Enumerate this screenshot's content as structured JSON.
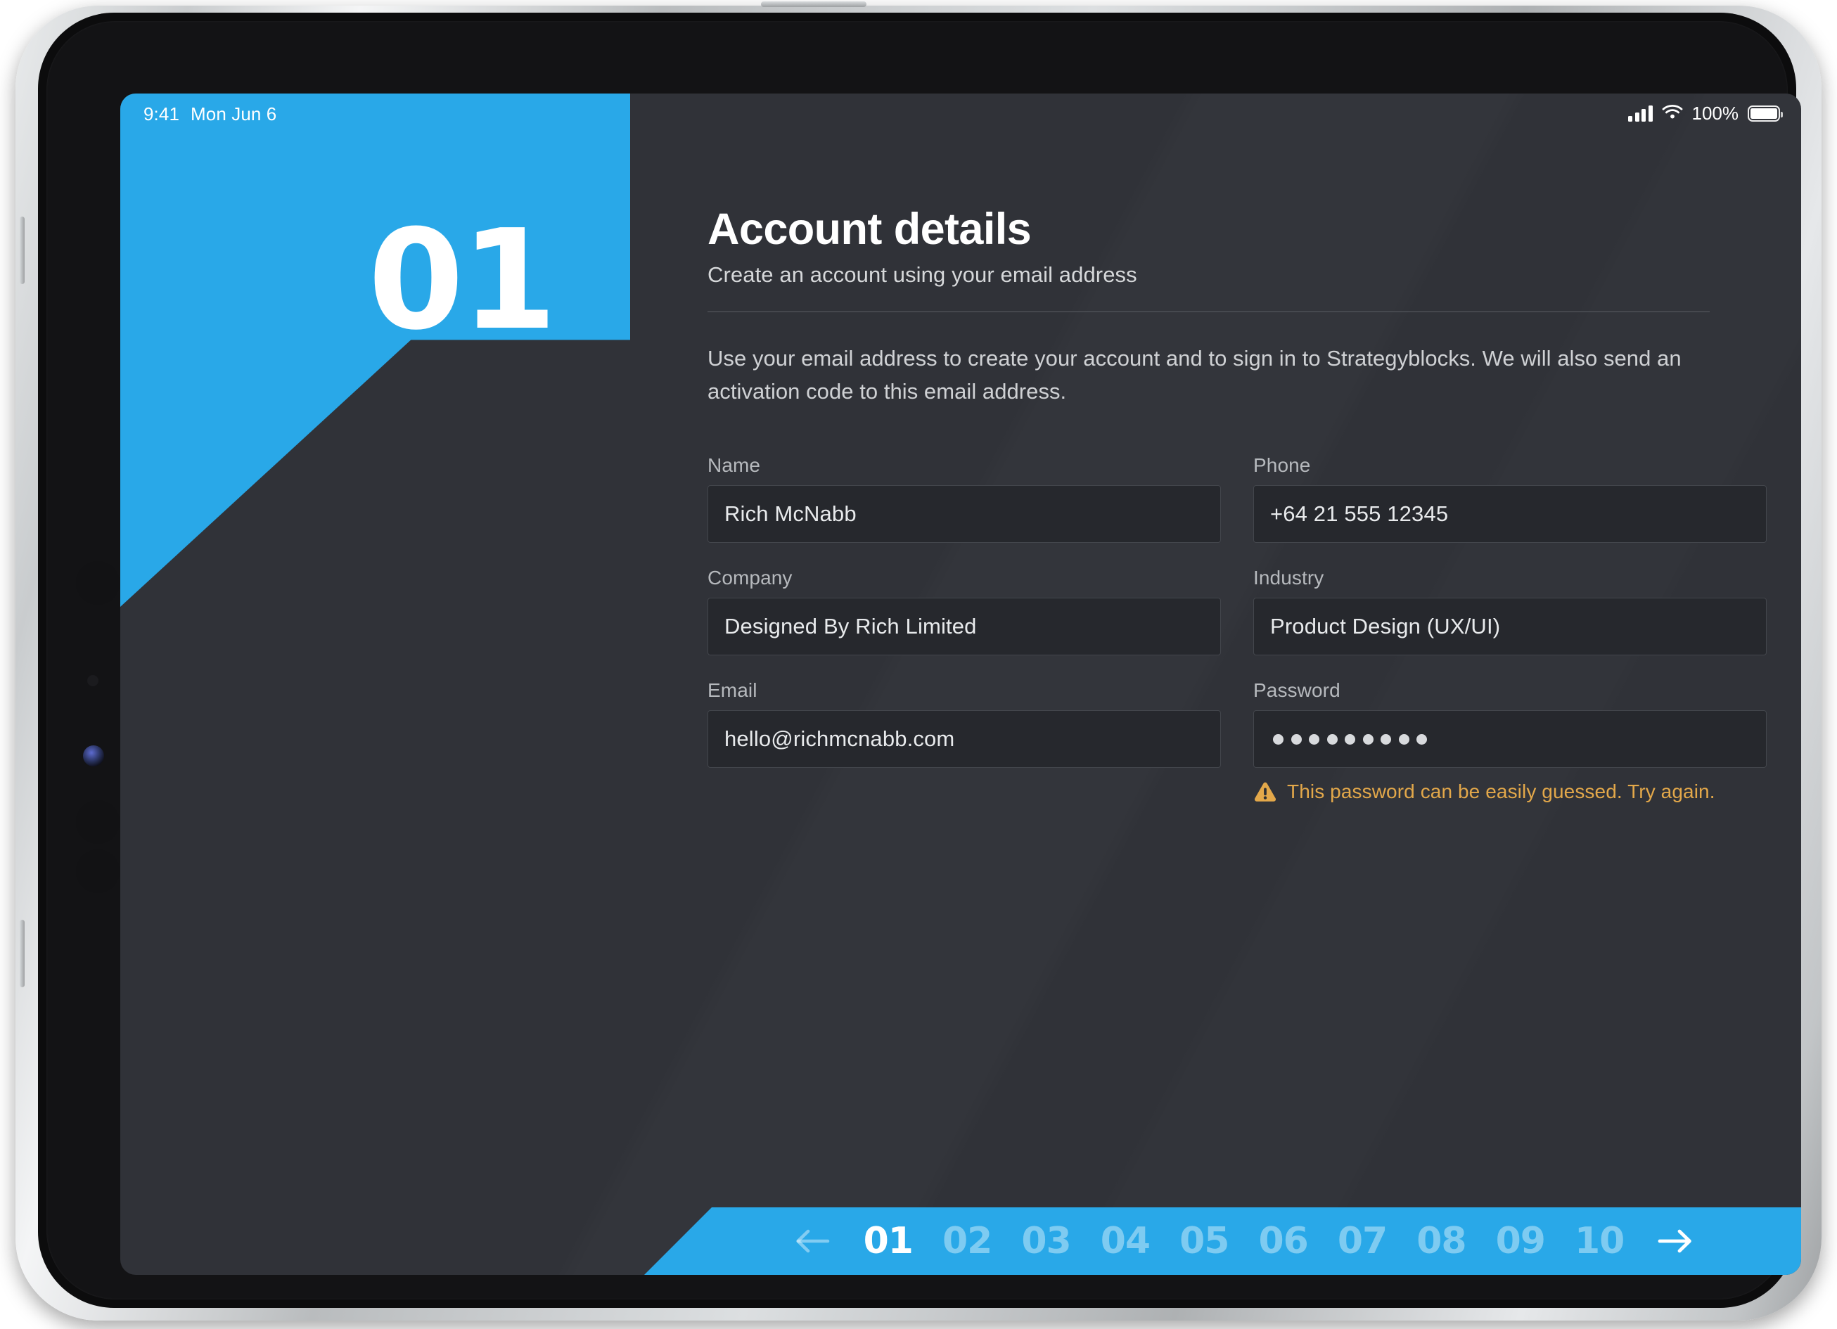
{
  "colors": {
    "accent": "#29a8e8",
    "canvas": "#303238",
    "field_fill": "#26282d",
    "field_border": "#43464c",
    "warning": "#e3a84a",
    "text_primary": "#ffffff",
    "text_secondary": "#cfd1d4"
  },
  "status_bar": {
    "time": "9:41",
    "date": "Mon Jun 6",
    "battery_percent": "100%",
    "signal_icon": "cellular-signal-icon",
    "wifi_icon": "wifi-icon",
    "battery_icon": "battery-full-icon"
  },
  "step_badge": {
    "number": "01"
  },
  "header": {
    "title": "Account details",
    "subtitle": "Create an account using your email address",
    "paragraph": "Use your email address to create your account and to sign in to Strategyblocks. We will also send an activation code to this email address."
  },
  "form": {
    "fields": [
      {
        "id": "name",
        "label": "Name",
        "value": "Rich McNabb",
        "type": "text"
      },
      {
        "id": "phone",
        "label": "Phone",
        "value": "+64 21 555 12345",
        "type": "text"
      },
      {
        "id": "company",
        "label": "Company",
        "value": "Designed By Rich Limited",
        "type": "text"
      },
      {
        "id": "industry",
        "label": "Industry",
        "value": "Product Design (UX/UI)",
        "type": "text"
      },
      {
        "id": "email",
        "label": "Email",
        "value": "hello@richmcnabb.com",
        "type": "email"
      },
      {
        "id": "password",
        "label": "Password",
        "value": "•••••••••",
        "masked_length": 9,
        "type": "password"
      }
    ],
    "password_error": {
      "icon": "warning-triangle-icon",
      "message": "This password can be easily guessed. Try again."
    }
  },
  "pager": {
    "prev_icon": "arrow-left-icon",
    "next_icon": "arrow-right-icon",
    "active_step": "01",
    "steps": [
      "01",
      "02",
      "03",
      "04",
      "05",
      "06",
      "07",
      "08",
      "09",
      "10"
    ]
  }
}
